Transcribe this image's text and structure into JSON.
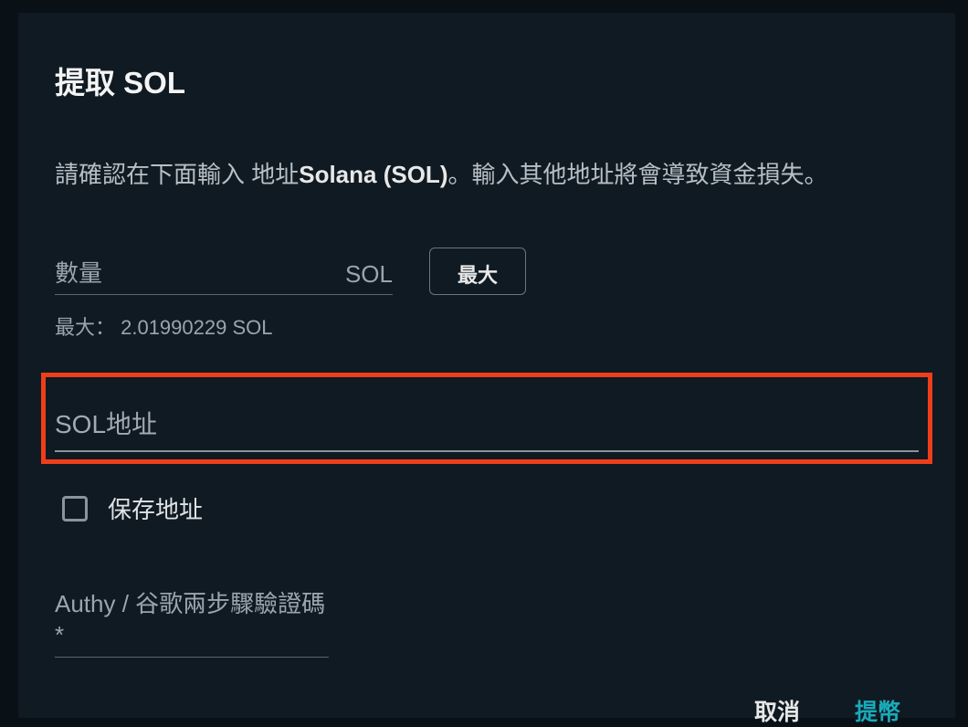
{
  "modal": {
    "title": "提取 SOL",
    "warning_prefix": "請確認在下面輸入 地址",
    "warning_bold": "Solana (SOL)",
    "warning_suffix": "。輸入其他地址將會導致資金損失。",
    "amount": {
      "label": "數量",
      "unit": "SOL",
      "max_button": "最大",
      "max_info": "最大： 2.01990229 SOL"
    },
    "address": {
      "label": "SOL地址"
    },
    "save_address": {
      "label": "保存地址",
      "checked": false
    },
    "twofa": {
      "label": "Authy / 谷歌兩步驟驗證碼 *"
    },
    "actions": {
      "cancel": "取消",
      "submit": "提幣"
    }
  },
  "colors": {
    "highlight_border": "#ee3e1a",
    "accent": "#1aaaba"
  }
}
